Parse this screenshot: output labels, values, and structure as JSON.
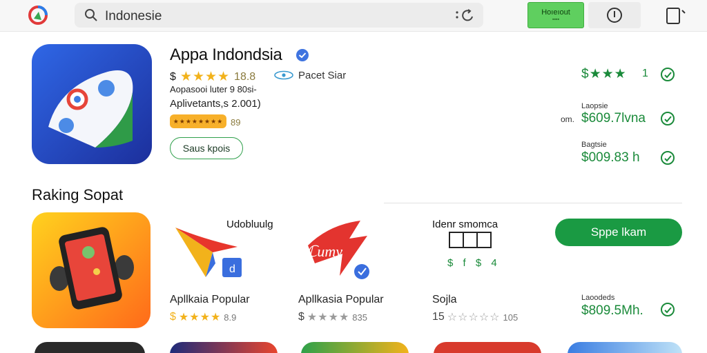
{
  "topbar": {
    "logo_icon": "store-logo-icon",
    "search_value": "Indonesie",
    "search_icon": "search-icon",
    "search_right_icon": "refresh-icon",
    "green_button": {
      "label": "Hoıeıout",
      "sub": "▪▪▪▪"
    },
    "info_icon": "info-icon",
    "device_icon": "device-icon"
  },
  "featured": {
    "title": "Appa Indondsia",
    "currency": "$",
    "stars": "★★★★",
    "rating": "18.8",
    "publisher": "Pacet Siar",
    "line2": "Aopasooi luter 9 80si-",
    "line3": "Aplivetants,s 2.001)",
    "badge_text": "★★★★★★★★",
    "badge_num": "89",
    "button_label": "Saus kpois"
  },
  "right_panel": {
    "stars": "$★★★",
    "count": "1",
    "label2": "Laopsie",
    "prefix2": "om.",
    "price2": "$609.7lvna",
    "label3": "Bagtsie",
    "price3": "$009.83 h",
    "label4": "Laoodeds",
    "price4": "$809.5Mh."
  },
  "ranking": {
    "title": "Raking Sopat",
    "apps": [
      {
        "name": "",
        "stars": "",
        "rating": ""
      },
      {
        "top_label": "Udobluulg",
        "name": "Apllkaia Popular",
        "prefix": "$",
        "stars": "★★★★",
        "rating": "8.9",
        "star_color": "gold"
      },
      {
        "top_label": "",
        "name": "Apllkasia Popular",
        "prefix": "$",
        "stars": "★★★★",
        "rating": "835",
        "star_color": "gray"
      },
      {
        "top_label": "Idenr smomca",
        "name": "Sojla",
        "prefix": "15",
        "stars": "☆☆☆☆☆",
        "rating": "105",
        "star_color": "gray"
      }
    ],
    "green_figs": "$ f $ 4",
    "cta_label": "Sppe lkam"
  },
  "colors": {
    "accent": "#1a9a43",
    "star": "#f2b21b",
    "header_bg": "#f7f7f7"
  }
}
